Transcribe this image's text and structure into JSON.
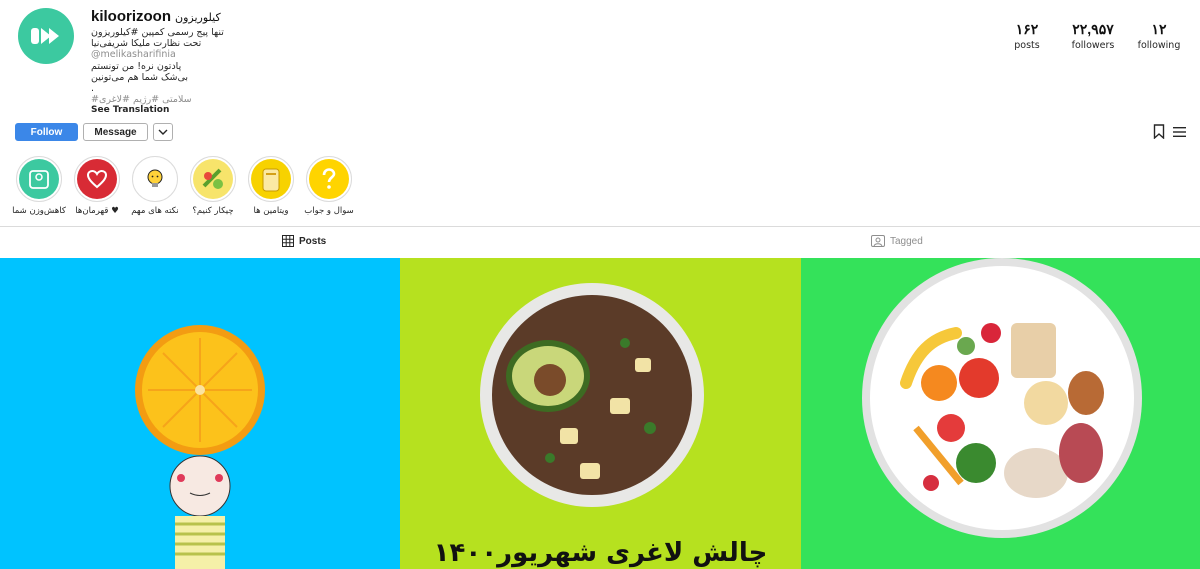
{
  "profile": {
    "username": "kiloorizoon",
    "full_name": "کیلوریزون",
    "bio_lines": [
      "تنها پیج رسمی کمپین #کیلوریزون",
      "تحت نظارت ملیکا شریفی‌نیا",
      "@melikasharifinia",
      "پادتون نره! من تونستم",
      "بی‌شک شما هم می‌تونین",
      ".",
      "#سلامتی #رژیم #لاغری",
      "See Translation"
    ]
  },
  "stats": [
    {
      "value": "۱۶۲",
      "label": "posts"
    },
    {
      "value": "۲۲,۹۵۷",
      "label": "followers"
    },
    {
      "value": "۱۲",
      "label": "following"
    }
  ],
  "buttons": {
    "follow": "Follow",
    "message": "Message"
  },
  "highlights": [
    {
      "label": "کاهش‌وزن شما",
      "icon": "scale-icon",
      "color": "#3cc9a0"
    },
    {
      "label": "قهرمان‌ها ♥",
      "icon": "heart-icon",
      "color": "#d82b35"
    },
    {
      "label": "نکته های مهم",
      "icon": "lightbulb-icon",
      "color": "#ffffff"
    },
    {
      "label": "چیکار کنیم؟",
      "icon": "salad-icon",
      "color": "#f7e46b"
    },
    {
      "label": "ویتامین ها",
      "icon": "vitamin-icon",
      "color": "#f7d200"
    },
    {
      "label": "سوال و جواب",
      "icon": "question-icon",
      "color": "#ffd400"
    }
  ],
  "tabs": {
    "posts": "Posts",
    "tagged": "Tagged"
  },
  "posts": [
    {
      "image": "orange-girl-illustration",
      "bg": "#00c3ff"
    },
    {
      "image": "avocado-bowl",
      "bg": "#b6e11f",
      "caption": "چالش لاغری شهریور۱۴۰۰"
    },
    {
      "image": "healthy-plate",
      "bg": "#34e25a"
    }
  ]
}
